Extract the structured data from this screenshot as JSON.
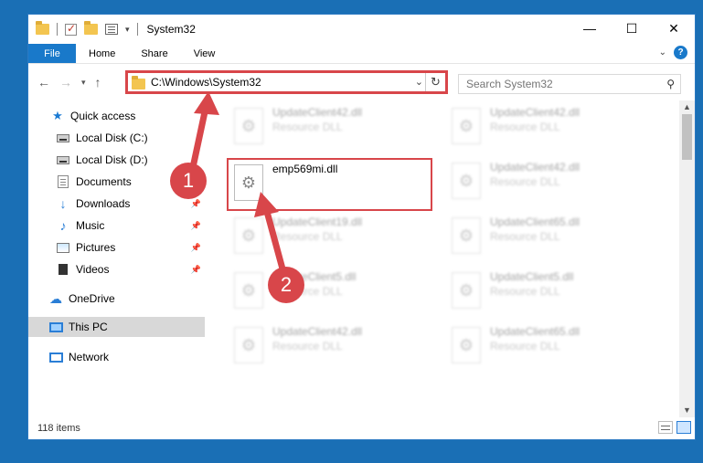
{
  "window": {
    "title": "System32",
    "controls": {
      "minimize": "—",
      "maximize": "☐",
      "close": "✕"
    }
  },
  "ribbon": {
    "tabs": [
      {
        "label": "File"
      },
      {
        "label": "Home"
      },
      {
        "label": "Share"
      },
      {
        "label": "View"
      }
    ],
    "help": "?"
  },
  "navigation": {
    "address": "C:\\Windows\\System32",
    "search_placeholder": "Search System32"
  },
  "sidebar": {
    "items": [
      {
        "label": "Quick access",
        "icon": "star-icon"
      },
      {
        "label": "Local Disk (C:)",
        "icon": "disk-icon"
      },
      {
        "label": "Local Disk (D:)",
        "icon": "disk-icon"
      },
      {
        "label": "Documents",
        "icon": "documents-icon"
      },
      {
        "label": "Downloads",
        "icon": "download-icon"
      },
      {
        "label": "Music",
        "icon": "music-icon"
      },
      {
        "label": "Pictures",
        "icon": "pictures-icon"
      },
      {
        "label": "Videos",
        "icon": "videos-icon"
      },
      {
        "label": "OneDrive",
        "icon": "cloud-icon"
      },
      {
        "label": "This PC",
        "icon": "pc-icon"
      },
      {
        "label": "Network",
        "icon": "network-icon"
      }
    ]
  },
  "files": {
    "selected": {
      "name": "emp569mi.dll"
    },
    "blurred": [
      {
        "name": "UpdateClient42.dll",
        "type": "Resource DLL"
      },
      {
        "name": "UpdateClient42.dll",
        "type": "Resource DLL"
      },
      {
        "name": "UpdateClient42.dll",
        "type": "Resource DLL"
      },
      {
        "name": "UpdateClient19.dll",
        "type": "Resource DLL"
      },
      {
        "name": "UpdateClient65.dll",
        "type": "Resource DLL"
      },
      {
        "name": "UpdateClient5.dll",
        "type": "Resource DLL"
      },
      {
        "name": "UpdateClient5.dll",
        "type": "Resource DLL"
      },
      {
        "name": "UpdateClient42.dll",
        "type": "Resource DLL"
      },
      {
        "name": "UpdateClient65.dll",
        "type": "Resource DLL"
      }
    ]
  },
  "status": {
    "count": "118 items"
  },
  "annotations": {
    "step1": "1",
    "step2": "2"
  },
  "colors": {
    "accent": "#1979ca",
    "highlight": "#d8464a",
    "desktop": "#1a6fb5"
  }
}
